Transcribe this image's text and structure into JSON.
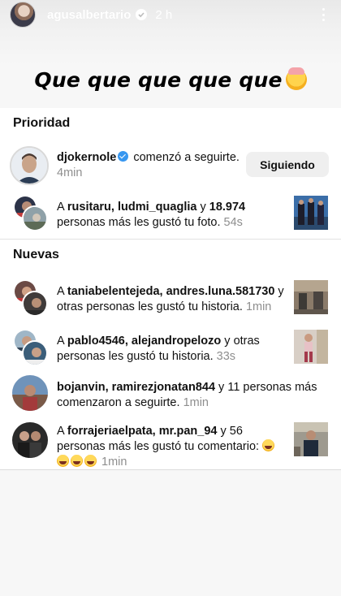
{
  "story": {
    "username": "agusalbertario",
    "time": "2 h",
    "caption": "Que que que que que"
  },
  "sections": {
    "priority_title": "Prioridad",
    "new_title": "Nuevas"
  },
  "priority": {
    "follow": {
      "username": "djokernole",
      "action": "comenzó a seguirte.",
      "time": "4min",
      "button_label": "Siguiendo"
    },
    "likes": {
      "prefix": "A",
      "users": "rusitaru, ludmi_quaglia",
      "connector": "y",
      "count": "18.974",
      "action": "personas más les gustó tu foto.",
      "time": "54s"
    }
  },
  "new_items": [
    {
      "prefix": "A",
      "users": "taniabelentejeda, andres.luna.581730",
      "connector": "y",
      "action": "otras personas les gustó tu historia.",
      "time": "1min"
    },
    {
      "prefix": "A",
      "users": "pablo4546, alejandropelozo",
      "connector": "y otras",
      "action": "personas les gustó tu historia.",
      "time": "33s"
    },
    {
      "users": "bojanvin, ramirezjonatan844",
      "connector": "y 11 personas más",
      "action": "comenzaron a seguirte.",
      "time": "1min"
    },
    {
      "prefix": "A",
      "users": "forrajeriaelpata, mr.pan_94",
      "connector": "y 56",
      "action": "personas más les gustó tu comentario:",
      "time": "1min"
    }
  ],
  "colors": {
    "verified": "#3797f0",
    "muted_time": "#8e8e8e",
    "button_bg": "#efefef"
  }
}
